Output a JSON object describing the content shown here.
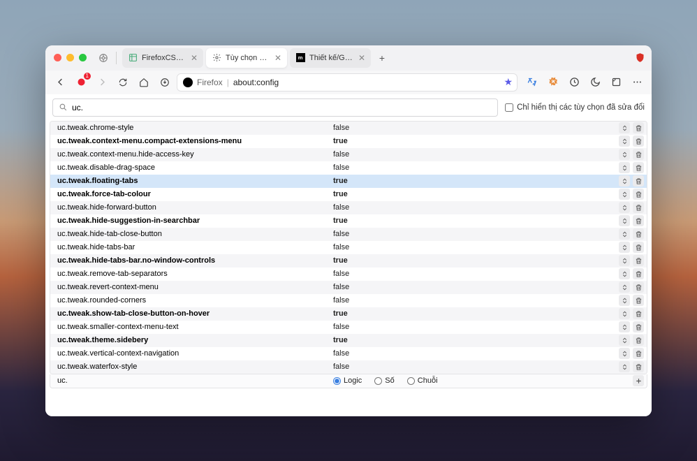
{
  "tabs": [
    {
      "label": "FirefoxCSS Store",
      "favicon": "template"
    },
    {
      "label": "Tùy chọn nâng cao",
      "favicon": "gear",
      "active": true
    },
    {
      "label": "Thiết kế/Giao diện Tab - Mozill...",
      "favicon": "matrix"
    }
  ],
  "url": {
    "scheme": "Firefox",
    "address": "about:config"
  },
  "search": {
    "value": "uc.",
    "checkbox_label": "Chỉ hiển thị các tùy chọn đã sửa đổi"
  },
  "prefs": [
    {
      "name": "uc.tweak.chrome-style",
      "value": "false",
      "bold": false
    },
    {
      "name": "uc.tweak.context-menu.compact-extensions-menu",
      "value": "true",
      "bold": true
    },
    {
      "name": "uc.tweak.context-menu.hide-access-key",
      "value": "false",
      "bold": false
    },
    {
      "name": "uc.tweak.disable-drag-space",
      "value": "false",
      "bold": false
    },
    {
      "name": "uc.tweak.floating-tabs",
      "value": "true",
      "bold": true,
      "highlighted": true
    },
    {
      "name": "uc.tweak.force-tab-colour",
      "value": "true",
      "bold": true
    },
    {
      "name": "uc.tweak.hide-forward-button",
      "value": "false",
      "bold": false
    },
    {
      "name": "uc.tweak.hide-suggestion-in-searchbar",
      "value": "true",
      "bold": true
    },
    {
      "name": "uc.tweak.hide-tab-close-button",
      "value": "false",
      "bold": false
    },
    {
      "name": "uc.tweak.hide-tabs-bar",
      "value": "false",
      "bold": false
    },
    {
      "name": "uc.tweak.hide-tabs-bar.no-window-controls",
      "value": "true",
      "bold": true
    },
    {
      "name": "uc.tweak.remove-tab-separators",
      "value": "false",
      "bold": false
    },
    {
      "name": "uc.tweak.revert-context-menu",
      "value": "false",
      "bold": false
    },
    {
      "name": "uc.tweak.rounded-corners",
      "value": "false",
      "bold": false
    },
    {
      "name": "uc.tweak.show-tab-close-button-on-hover",
      "value": "true",
      "bold": true
    },
    {
      "name": "uc.tweak.smaller-context-menu-text",
      "value": "false",
      "bold": false
    },
    {
      "name": "uc.tweak.theme.sidebery",
      "value": "true",
      "bold": true
    },
    {
      "name": "uc.tweak.vertical-context-navigation",
      "value": "false",
      "bold": false
    },
    {
      "name": "uc.tweak.waterfox-style",
      "value": "false",
      "bold": false
    }
  ],
  "add_row": {
    "name": "uc.",
    "options": [
      "Logic",
      "Số",
      "Chuỗi"
    ],
    "selected": 0
  }
}
